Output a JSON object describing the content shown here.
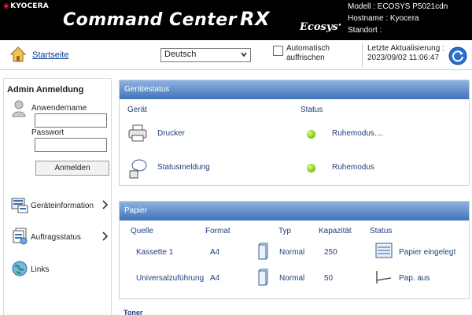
{
  "header": {
    "brand": "KYOCERA",
    "title": "Command Center",
    "title_suffix": "RX",
    "ecosys_logo": "Ecosys",
    "model": "Modell : ECOSYS P5021cdn",
    "hostname": "Hostname : Kyocera",
    "location": "Standort :"
  },
  "toolbar": {
    "home_label": "Startseite",
    "language_value": "Deutsch",
    "auto_refresh_label": "Automatisch auffrischen",
    "last_update_label": "Letzte Aktualisierung :",
    "last_update_value": "2023/09/02 11:06:47"
  },
  "sidebar": {
    "admin_title": "Admin Anmeldung",
    "username_label": "Anwendername",
    "password_label": "Passwort",
    "username_value": "",
    "password_value": "",
    "login_button": "Anmelden",
    "nav": [
      {
        "label": "Geräteinformation",
        "icon": "device-info-icon"
      },
      {
        "label": "Auftragsstatus",
        "icon": "job-status-icon"
      },
      {
        "label": "Links",
        "icon": "links-icon"
      }
    ]
  },
  "device_status": {
    "title": "Gerätestatus",
    "col_device": "Gerät",
    "col_status": "Status",
    "rows": [
      {
        "device": "Drucker",
        "status": "Ruhemodus....",
        "icon": "printer-icon",
        "led_color": "#7fcf1f"
      },
      {
        "device": "Statusmeldung",
        "status": "Ruhemodus",
        "icon": "status-message-icon",
        "led_color": "#7fcf1f"
      }
    ]
  },
  "paper": {
    "title": "Papier",
    "col_source": "Quelle",
    "col_format": "Format",
    "col_type": "Typ",
    "col_capacity": "Kapazität",
    "col_status": "Status",
    "rows": [
      {
        "source": "Kassette 1",
        "format": "A4",
        "type": "Normal",
        "capacity": "250",
        "status": "Papier eingelegt",
        "status_icon": "paper-stack-icon"
      },
      {
        "source": "Universalzuführung",
        "format": "A4",
        "type": "Normal",
        "capacity": "50",
        "status": "Pap. aus",
        "status_icon": "paper-empty-icon"
      }
    ]
  },
  "toner": {
    "title": "Toner"
  },
  "colors": {
    "header_bg": "#000000",
    "panel_header_start": "#8fb3e0",
    "panel_header_end": "#3f73b9",
    "link_blue": "#0b3d91",
    "brand_red": "#e21c2b"
  }
}
